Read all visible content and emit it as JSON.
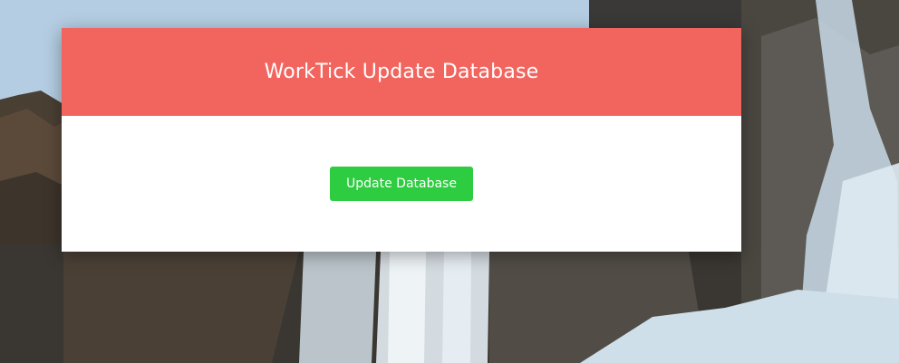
{
  "card": {
    "title": "WorkTick Update Database",
    "button_label": "Update Database"
  },
  "colors": {
    "header": "#f2655f",
    "button": "#2ecc40",
    "card_background": "#ffffff"
  }
}
